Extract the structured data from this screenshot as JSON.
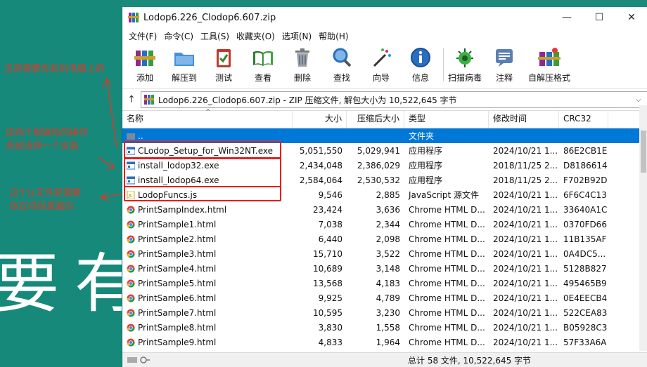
{
  "background": {
    "big_text": "要有",
    "annotations": [
      {
        "text": "这是需要安装到电脑上的"
      },
      {
        "text": "这两个根据你的操作\n系统选择一个安装"
      },
      {
        "text": "这个js文件是需要\n放在项目里面的"
      }
    ]
  },
  "window": {
    "title": "Lodop6.226_Clodop6.607.zip",
    "controls": {
      "minimize": "—",
      "maximize": "☐",
      "close": "✕"
    }
  },
  "menu": [
    "文件(F)",
    "命令(C)",
    "工具(S)",
    "收藏夹(O)",
    "选项(N)",
    "帮助(H)"
  ],
  "toolbar": [
    {
      "label": "添加",
      "icon": "books-add-icon"
    },
    {
      "label": "解压到",
      "icon": "folder-extract-icon"
    },
    {
      "label": "测试",
      "icon": "clipboard-test-icon"
    },
    {
      "label": "查看",
      "icon": "book-view-icon"
    },
    {
      "label": "删除",
      "icon": "trash-icon"
    },
    {
      "label": "查找",
      "icon": "magnifier-icon"
    },
    {
      "label": "向导",
      "icon": "wizard-wand-icon"
    },
    {
      "label": "信息",
      "icon": "info-icon"
    },
    {
      "label": "扫描病毒",
      "icon": "virus-scan-icon"
    },
    {
      "label": "注释",
      "icon": "comment-icon"
    },
    {
      "label": "自解压格式",
      "icon": "sfx-icon"
    }
  ],
  "address": {
    "text": "Lodop6.226_Clodop6.607.zip - ZIP 压缩文件, 解包大小为 10,522,645 字节"
  },
  "columns": {
    "name": "名称",
    "size": "大小",
    "packed": "压缩后大小",
    "type": "类型",
    "modified": "修改时间",
    "crc": "CRC32"
  },
  "files": [
    {
      "name": "..",
      "size": "",
      "packed": "",
      "type": "文件夹",
      "modified": "",
      "crc": "",
      "kind": "folder"
    },
    {
      "name": "CLodop_Setup_for_Win32NT.exe",
      "size": "5,051,550",
      "packed": "5,029,941",
      "type": "应用程序",
      "modified": "2024/10/21 1...",
      "crc": "86E2CB1E",
      "kind": "exe"
    },
    {
      "name": "install_lodop32.exe",
      "size": "2,434,048",
      "packed": "2,386,029",
      "type": "应用程序",
      "modified": "2018/11/25 2...",
      "crc": "D8186614",
      "kind": "exe"
    },
    {
      "name": "install_lodop64.exe",
      "size": "2,584,064",
      "packed": "2,530,532",
      "type": "应用程序",
      "modified": "2018/11/25 2...",
      "crc": "F702B92D",
      "kind": "exe"
    },
    {
      "name": "LodopFuncs.js",
      "size": "9,546",
      "packed": "2,885",
      "type": "JavaScript 源文件",
      "modified": "2024/10/21 1...",
      "crc": "6F6C4C13",
      "kind": "js"
    },
    {
      "name": "PrintSampIndex.html",
      "size": "23,424",
      "packed": "3,636",
      "type": "Chrome HTML D...",
      "modified": "2024/10/21 1...",
      "crc": "33640A1C",
      "kind": "html"
    },
    {
      "name": "PrintSample1.html",
      "size": "7,038",
      "packed": "2,344",
      "type": "Chrome HTML D...",
      "modified": "2024/10/21 1...",
      "crc": "0370FD66",
      "kind": "html"
    },
    {
      "name": "PrintSample2.html",
      "size": "6,440",
      "packed": "2,098",
      "type": "Chrome HTML D...",
      "modified": "2024/10/21 1...",
      "crc": "11B135AF",
      "kind": "html"
    },
    {
      "name": "PrintSample3.html",
      "size": "15,710",
      "packed": "3,522",
      "type": "Chrome HTML D...",
      "modified": "2024/10/21 1...",
      "crc": "0A4DC5...",
      "kind": "html"
    },
    {
      "name": "PrintSample4.html",
      "size": "10,689",
      "packed": "3,148",
      "type": "Chrome HTML D...",
      "modified": "2024/10/21 1...",
      "crc": "5128B827",
      "kind": "html"
    },
    {
      "name": "PrintSample5.html",
      "size": "13,568",
      "packed": "4,183",
      "type": "Chrome HTML D...",
      "modified": "2024/10/21 1...",
      "crc": "495465B9",
      "kind": "html"
    },
    {
      "name": "PrintSample6.html",
      "size": "9,925",
      "packed": "4,789",
      "type": "Chrome HTML D...",
      "modified": "2024/10/21 1...",
      "crc": "0E4EECB4",
      "kind": "html"
    },
    {
      "name": "PrintSample7.html",
      "size": "10,595",
      "packed": "3,230",
      "type": "Chrome HTML D...",
      "modified": "2024/10/21 1...",
      "crc": "522CEA83",
      "kind": "html"
    },
    {
      "name": "PrintSample8.html",
      "size": "3,830",
      "packed": "1,558",
      "type": "Chrome HTML D...",
      "modified": "2024/10/21 1...",
      "crc": "B05928C3",
      "kind": "html"
    },
    {
      "name": "PrintSample9.html",
      "size": "4,833",
      "packed": "1,964",
      "type": "Chrome HTML D...",
      "modified": "2024/10/21 1...",
      "crc": "57F33A6A",
      "kind": "html"
    }
  ],
  "status": {
    "right": "总计 58 文件, 10,522,645 字节"
  }
}
